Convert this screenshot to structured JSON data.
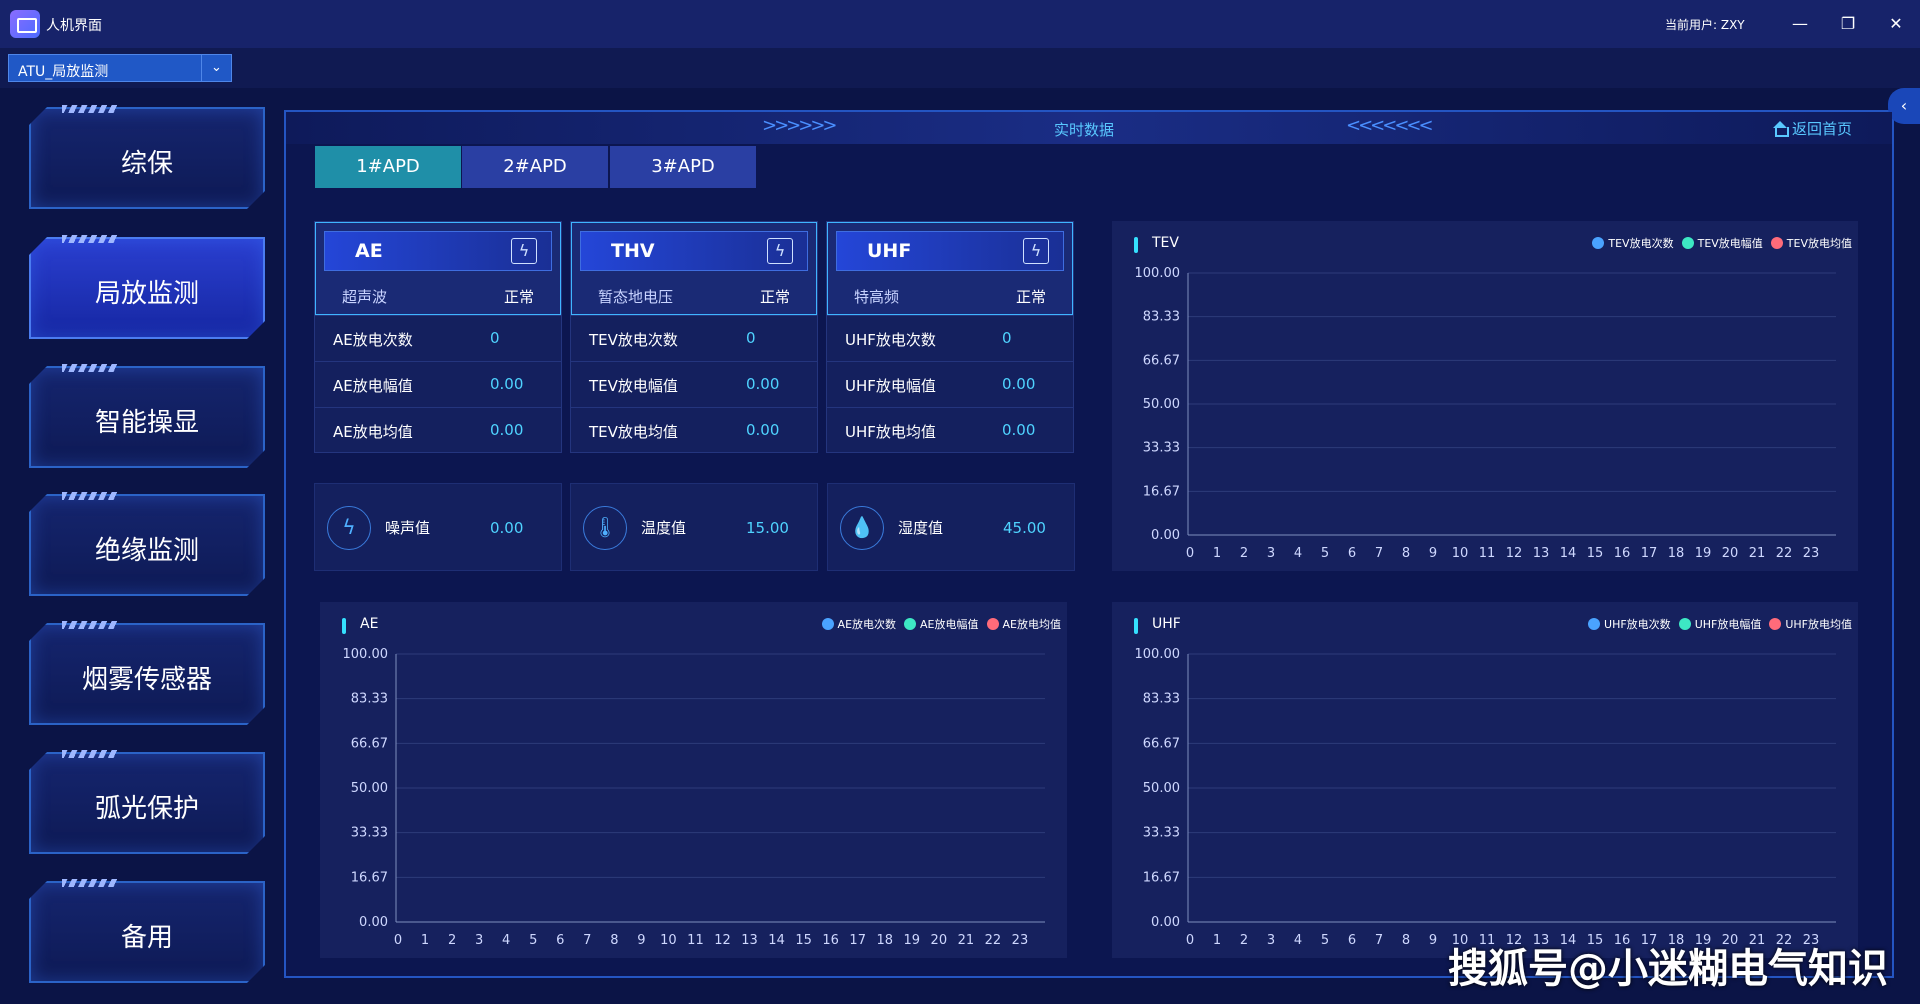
{
  "window": {
    "title": "人机界面",
    "current_user": "当前用户:  ZXY",
    "minimize": "—",
    "maximize": "❐",
    "close": "✕"
  },
  "module_select": {
    "value": "ATU_局放监测",
    "arrow": "⌄"
  },
  "nav": [
    {
      "label": "综保",
      "active": false
    },
    {
      "label": "局放监测",
      "active": true
    },
    {
      "label": "智能操显",
      "active": false
    },
    {
      "label": "绝缘监测",
      "active": false
    },
    {
      "label": "烟雾传感器",
      "active": false
    },
    {
      "label": "弧光保护",
      "active": false
    },
    {
      "label": "备用",
      "active": false
    }
  ],
  "header": {
    "title": "实时数据",
    "back_home": "返回首页",
    "chevrons_left": ">>>>>>",
    "chevrons_right": "<<<<<<<",
    "collapse": "‹"
  },
  "tabs": [
    {
      "label": "1#APD",
      "active": true
    },
    {
      "label": "2#APD",
      "active": false
    },
    {
      "label": "3#APD",
      "active": false
    }
  ],
  "sensors": [
    {
      "name": "AE",
      "sub": "超声波",
      "status": "正常",
      "metrics": [
        {
          "label": "AE放电次数",
          "value": "0"
        },
        {
          "label": "AE放电幅值",
          "value": "0.00"
        },
        {
          "label": "AE放电均值",
          "value": "0.00"
        }
      ]
    },
    {
      "name": "THV",
      "sub": "暂态地电压",
      "status": "正常",
      "metrics": [
        {
          "label": "TEV放电次数",
          "value": "0"
        },
        {
          "label": "TEV放电幅值",
          "value": "0.00"
        },
        {
          "label": "TEV放电均值",
          "value": "0.00"
        }
      ]
    },
    {
      "name": "UHF",
      "sub": "特高频",
      "status": "正常",
      "metrics": [
        {
          "label": "UHF放电次数",
          "value": "0"
        },
        {
          "label": "UHF放电幅值",
          "value": "0.00"
        },
        {
          "label": "UHF放电均值",
          "value": "0.00"
        }
      ]
    }
  ],
  "environment": [
    {
      "label": "噪声值",
      "value": "0.00",
      "icon": "noise-icon",
      "glyph": "ϟ"
    },
    {
      "label": "温度值",
      "value": "15.00",
      "icon": "thermometer-icon",
      "glyph": "🌡"
    },
    {
      "label": "湿度值",
      "value": "45.00",
      "icon": "humidity-icon",
      "glyph": "💧"
    }
  ],
  "chart_data": [
    {
      "type": "line",
      "title": "TEV",
      "x": [
        0,
        1,
        2,
        3,
        4,
        5,
        6,
        7,
        8,
        9,
        10,
        11,
        12,
        13,
        14,
        15,
        16,
        17,
        18,
        19,
        20,
        21,
        22,
        23
      ],
      "yticks": [
        "0.00",
        "16.67",
        "33.33",
        "50.00",
        "66.67",
        "83.33",
        "100.00"
      ],
      "ylim": [
        0,
        100
      ],
      "series": [
        {
          "name": "TEV放电次数",
          "color": "#4aa3ff",
          "values": []
        },
        {
          "name": "TEV放电幅值",
          "color": "#3de8c4",
          "values": []
        },
        {
          "name": "TEV放电均值",
          "color": "#ff6b7a",
          "values": []
        }
      ],
      "legend": "top-right",
      "grid": true
    },
    {
      "type": "line",
      "title": "AE",
      "x": [
        0,
        1,
        2,
        3,
        4,
        5,
        6,
        7,
        8,
        9,
        10,
        11,
        12,
        13,
        14,
        15,
        16,
        17,
        18,
        19,
        20,
        21,
        22,
        23
      ],
      "yticks": [
        "0.00",
        "16.67",
        "33.33",
        "50.00",
        "66.67",
        "83.33",
        "100.00"
      ],
      "ylim": [
        0,
        100
      ],
      "series": [
        {
          "name": "AE放电次数",
          "color": "#4aa3ff",
          "values": []
        },
        {
          "name": "AE放电幅值",
          "color": "#3de8c4",
          "values": []
        },
        {
          "name": "AE放电均值",
          "color": "#ff6b7a",
          "values": []
        }
      ],
      "legend": "top-right",
      "grid": true
    },
    {
      "type": "line",
      "title": "UHF",
      "x": [
        0,
        1,
        2,
        3,
        4,
        5,
        6,
        7,
        8,
        9,
        10,
        11,
        12,
        13,
        14,
        15,
        16,
        17,
        18,
        19,
        20,
        21,
        22,
        23
      ],
      "yticks": [
        "0.00",
        "16.67",
        "33.33",
        "50.00",
        "66.67",
        "83.33",
        "100.00"
      ],
      "ylim": [
        0,
        100
      ],
      "series": [
        {
          "name": "UHF放电次数",
          "color": "#4aa3ff",
          "values": []
        },
        {
          "name": "UHF放电幅值",
          "color": "#3de8c4",
          "values": []
        },
        {
          "name": "UHF放电均值",
          "color": "#ff6b7a",
          "values": []
        }
      ],
      "legend": "top-right",
      "grid": true
    }
  ],
  "watermark": "搜狐号@小迷糊电气知识"
}
